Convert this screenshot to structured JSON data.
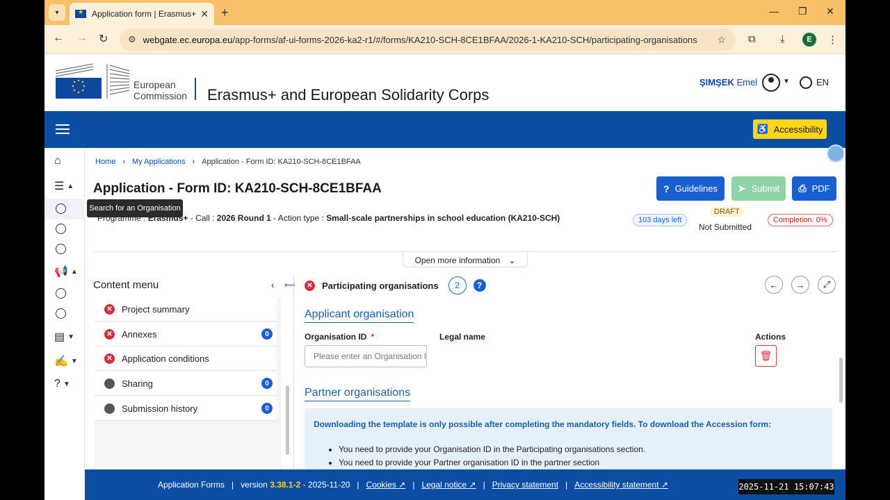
{
  "browser": {
    "tab_title": "Application form | Erasmus+ and European Solidarity Corps",
    "url_host": "webgate.ec.europa.eu",
    "url_path": "/app-forms/af-ui-forms-2026-ka2-r1/#/forms/KA210-SCH-8CE1BFAA/2026-1-KA210-SCH/participating-organisations",
    "profile_initial": "E"
  },
  "header": {
    "ec_line1": "European",
    "ec_line2": "Commission",
    "site_title": "Erasmus+ and European Solidarity Corps",
    "user_surname": "ŞIMŞEK",
    "user_name": "Emel",
    "language": "EN",
    "accessibility_label": "Accessibility"
  },
  "tooltip": "Search for an Organisation",
  "breadcrumb": {
    "home": "Home",
    "my_applications": "My Applications",
    "current": "Application - Form ID: KA210-SCH-8CE1BFAA"
  },
  "page": {
    "title": "Application - Form ID: KA210-SCH-8CE1BFAA",
    "buttons": {
      "guidelines": "Guidelines",
      "submit": "Submit",
      "pdf": "PDF"
    },
    "programme_label": "Programme :",
    "programme": "Erasmus+",
    "call_label": "- Call :",
    "call": "2026 Round 1",
    "action_label": "- Action type :",
    "action": "Small-scale partnerships in school education (KA210-SCH)",
    "days_left": "103 days left",
    "draft": "DRAFT",
    "status": "Not Submitted",
    "completion": "Completion: 0%",
    "open_more": "Open more information"
  },
  "content_menu": {
    "title": "Content menu",
    "items": [
      {
        "label": "Project summary",
        "status": "error",
        "count": ""
      },
      {
        "label": "Annexes",
        "status": "error",
        "count": "0"
      },
      {
        "label": "Application conditions",
        "status": "error",
        "count": ""
      },
      {
        "label": "Sharing",
        "status": "neutral",
        "count": "0"
      },
      {
        "label": "Submission history",
        "status": "neutral",
        "count": "0"
      }
    ]
  },
  "section": {
    "title": "Participating organisations",
    "count": "2",
    "applicant_heading": "Applicant organisation",
    "col_org_id": "Organisation ID",
    "required_mark": "*",
    "col_legal_name": "Legal name",
    "col_actions": "Actions",
    "org_id_placeholder": "Please enter an Organisation ID",
    "partner_heading": "Partner organisations",
    "info_head": "Downloading the template is only possible after completing the mandatory fields. To download the Accession form:",
    "info_items": [
      "You need to provide your Organisation ID in the Participating organisations section.",
      "You need to provide your Partner organisation ID in the partner section"
    ]
  },
  "footer": {
    "app_forms": "Application Forms",
    "version_label": "version",
    "version": "3.38.1-2",
    "version_date": "- 2025-11-20",
    "cookies": "Cookies",
    "legal": "Legal notice",
    "privacy": "Privacy statement",
    "accessibility": "Accessibility statement"
  },
  "overlay_timestamp": "2025-11-21 15:07:43",
  "colors": {
    "brand_blue": "#0b4da2",
    "accent_yellow": "#ffd617",
    "error_red": "#d32f3f"
  }
}
